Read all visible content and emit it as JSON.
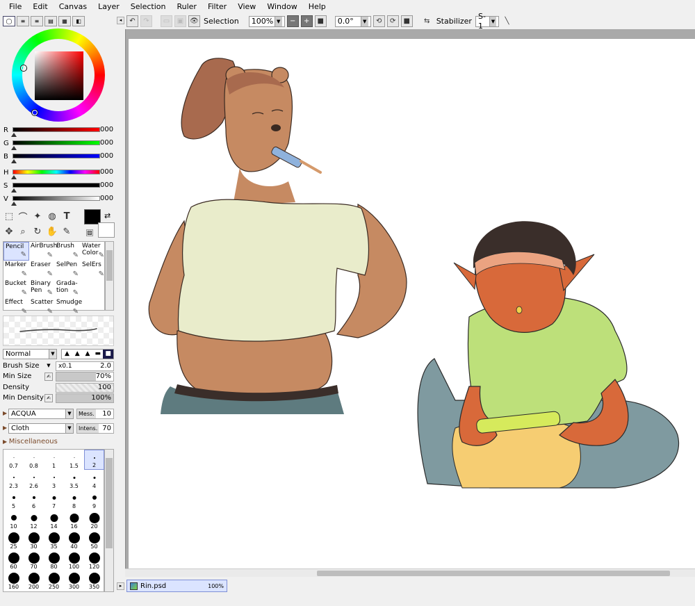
{
  "menu": [
    "File",
    "Edit",
    "Canvas",
    "Layer",
    "Selection",
    "Ruler",
    "Filter",
    "View",
    "Window",
    "Help"
  ],
  "toolbar": {
    "selection_label": "Selection",
    "zoom_value": "100%",
    "rotation_value": "0.0°",
    "stabilizer_label": "Stabilizer",
    "stabilizer_value": "S-1"
  },
  "color": {
    "current_hex": "#000000",
    "background_hex": "#ffffff",
    "sliders": [
      {
        "label": "R",
        "value": "000",
        "gradient": "linear-gradient(to right,#000,#ff0000)"
      },
      {
        "label": "G",
        "value": "000",
        "gradient": "linear-gradient(to right,#000,#00ff00)"
      },
      {
        "label": "B",
        "value": "000",
        "gradient": "linear-gradient(to right,#000,#0000ff)"
      },
      {
        "label": "H",
        "value": "000",
        "gradient": "linear-gradient(to right,#ff0000,#ffff00,#00ff00,#00ffff,#0000ff,#ff00ff,#ff0000)"
      },
      {
        "label": "S",
        "value": "000",
        "gradient": "linear-gradient(to right,#000,#000)"
      },
      {
        "label": "V",
        "value": "000",
        "gradient": "linear-gradient(to right,#000,#fff)"
      }
    ]
  },
  "brushes": [
    {
      "label": "Pencil",
      "selected": true
    },
    {
      "label": "AirBrush",
      "selected": false
    },
    {
      "label": "Brush",
      "selected": false
    },
    {
      "label": "Water Color",
      "selected": false
    },
    {
      "label": "Marker",
      "selected": false
    },
    {
      "label": "Eraser",
      "selected": false
    },
    {
      "label": "SelPen",
      "selected": false
    },
    {
      "label": "SelErs",
      "selected": false
    },
    {
      "label": "Bucket",
      "selected": false
    },
    {
      "label": "Binary Pen",
      "selected": false
    },
    {
      "label": "Grada-tion",
      "selected": false
    },
    {
      "label": "",
      "selected": false
    },
    {
      "label": "Effect",
      "selected": false
    },
    {
      "label": "Scatter",
      "selected": false
    },
    {
      "label": "Smudge",
      "selected": false
    },
    {
      "label": "",
      "selected": false
    }
  ],
  "brush_settings": {
    "blend_mode": "Normal",
    "brush_size_label": "Brush Size",
    "brush_size_multiplier": "x0.1",
    "brush_size_value": "2.0",
    "min_size_label": "Min Size",
    "min_size_value": "70%",
    "min_size_fraction": 0.7,
    "density_label": "Density",
    "density_value": "100",
    "density_fraction": 1.0,
    "min_density_label": "Min Density",
    "min_density_value": "100%",
    "min_density_fraction": 1.0,
    "texture_1": "ACQUA",
    "texture_1_param_label": "Mess.",
    "texture_1_param_value": "10",
    "texture_2": "Cloth",
    "texture_2_param_label": "Intens.",
    "texture_2_param_value": "70",
    "misc_label": "Miscellaneous"
  },
  "brush_sizes": [
    {
      "label": "0.7",
      "dot": 1
    },
    {
      "label": "0.8",
      "dot": 1
    },
    {
      "label": "1",
      "dot": 1
    },
    {
      "label": "1.5",
      "dot": 1
    },
    {
      "label": "2",
      "dot": 2,
      "selected": true
    },
    {
      "label": "2.3",
      "dot": 2
    },
    {
      "label": "2.6",
      "dot": 2
    },
    {
      "label": "3",
      "dot": 2
    },
    {
      "label": "3.5",
      "dot": 3
    },
    {
      "label": "4",
      "dot": 3
    },
    {
      "label": "5",
      "dot": 4
    },
    {
      "label": "6",
      "dot": 4
    },
    {
      "label": "7",
      "dot": 5
    },
    {
      "label": "8",
      "dot": 5
    },
    {
      "label": "9",
      "dot": 6
    },
    {
      "label": "10",
      "dot": 8
    },
    {
      "label": "12",
      "dot": 9
    },
    {
      "label": "14",
      "dot": 11
    },
    {
      "label": "16",
      "dot": 13
    },
    {
      "label": "20",
      "dot": 15
    },
    {
      "label": "25",
      "dot": 16
    },
    {
      "label": "30",
      "dot": 16
    },
    {
      "label": "35",
      "dot": 16
    },
    {
      "label": "40",
      "dot": 16
    },
    {
      "label": "50",
      "dot": 16
    },
    {
      "label": "60",
      "dot": 16
    },
    {
      "label": "70",
      "dot": 16
    },
    {
      "label": "80",
      "dot": 16
    },
    {
      "label": "100",
      "dot": 16
    },
    {
      "label": "120",
      "dot": 16
    },
    {
      "label": "160",
      "dot": 16
    },
    {
      "label": "200",
      "dot": 16
    },
    {
      "label": "250",
      "dot": 16
    },
    {
      "label": "300",
      "dot": 16
    },
    {
      "label": "350",
      "dot": 16
    }
  ],
  "document": {
    "name": "Rin.psd",
    "zoom": "100%"
  },
  "colors": {
    "skin_bear": "#c68a62",
    "hair_bear": "#a86a4e",
    "shirt_bear": "#e9eccb",
    "jeans": "#5e7b7f",
    "skin_goblin": "#d8693a",
    "shirt_goblin": "#bde07a",
    "pants_goblin": "#7f9aa0",
    "pillow": "#f6cd72"
  }
}
